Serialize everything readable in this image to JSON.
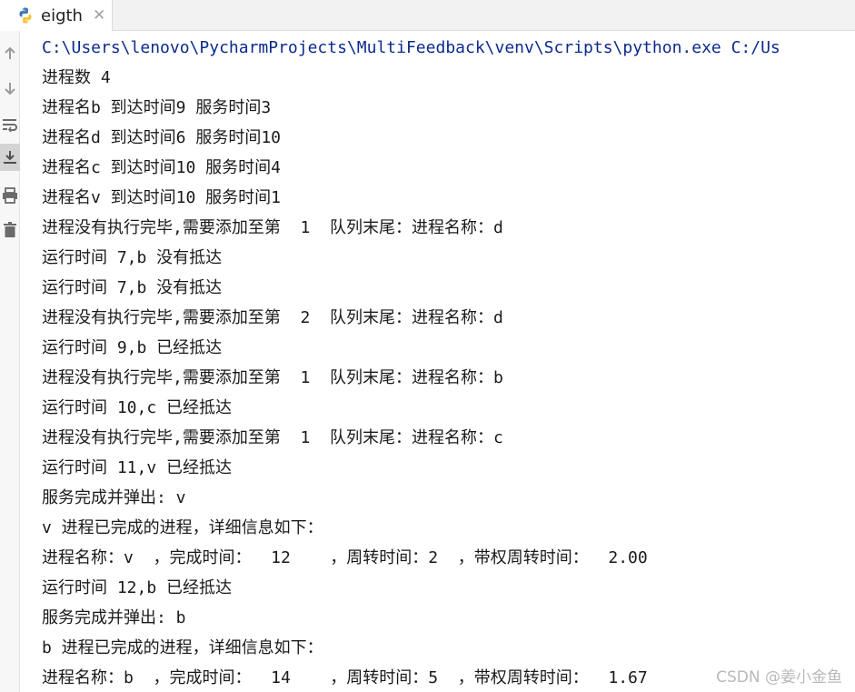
{
  "tab": {
    "label": "eigth",
    "icon": "python-icon"
  },
  "toolbar": {
    "buttons": [
      {
        "icon": "arrow-up-icon"
      },
      {
        "icon": "arrow-down-icon"
      },
      {
        "icon": "soft-wrap-icon"
      },
      {
        "icon": "scroll-to-end-icon"
      },
      {
        "icon": "print-icon"
      },
      {
        "icon": "trash-icon"
      }
    ]
  },
  "console": {
    "lines": [
      "C:\\Users\\lenovo\\PycharmProjects\\MultiFeedback\\venv\\Scripts\\python.exe C:/Us",
      "进程数 4",
      "进程名b 到达时间9 服务时间3",
      "进程名d 到达时间6 服务时间10",
      "进程名c 到达时间10 服务时间4",
      "进程名v 到达时间10 服务时间1",
      "进程没有执行完毕,需要添加至第  1  队列末尾：进程名称：d",
      "运行时间 7,b 没有抵达",
      "运行时间 7,b 没有抵达",
      "进程没有执行完毕,需要添加至第  2  队列末尾：进程名称：d",
      "运行时间 9,b 已经抵达",
      "进程没有执行完毕,需要添加至第  1  队列末尾：进程名称：b",
      "运行时间 10,c 已经抵达",
      "进程没有执行完毕,需要添加至第  1  队列末尾：进程名称：c",
      "运行时间 11,v 已经抵达",
      "服务完成并弹出: v",
      "v 进程已完成的进程，详细信息如下：",
      "进程名称：v  ，完成时间：  12    ，周转时间：2  ，带权周转时间：  2.00",
      "运行时间 12,b 已经抵达",
      "服务完成并弹出: b",
      "b 进程已完成的进程，详细信息如下：",
      "进程名称：b  ，完成时间：  14    ，周转时间：5  ，带权周转时间：  1.67"
    ]
  },
  "watermark": "CSDN @姜小金鱼"
}
